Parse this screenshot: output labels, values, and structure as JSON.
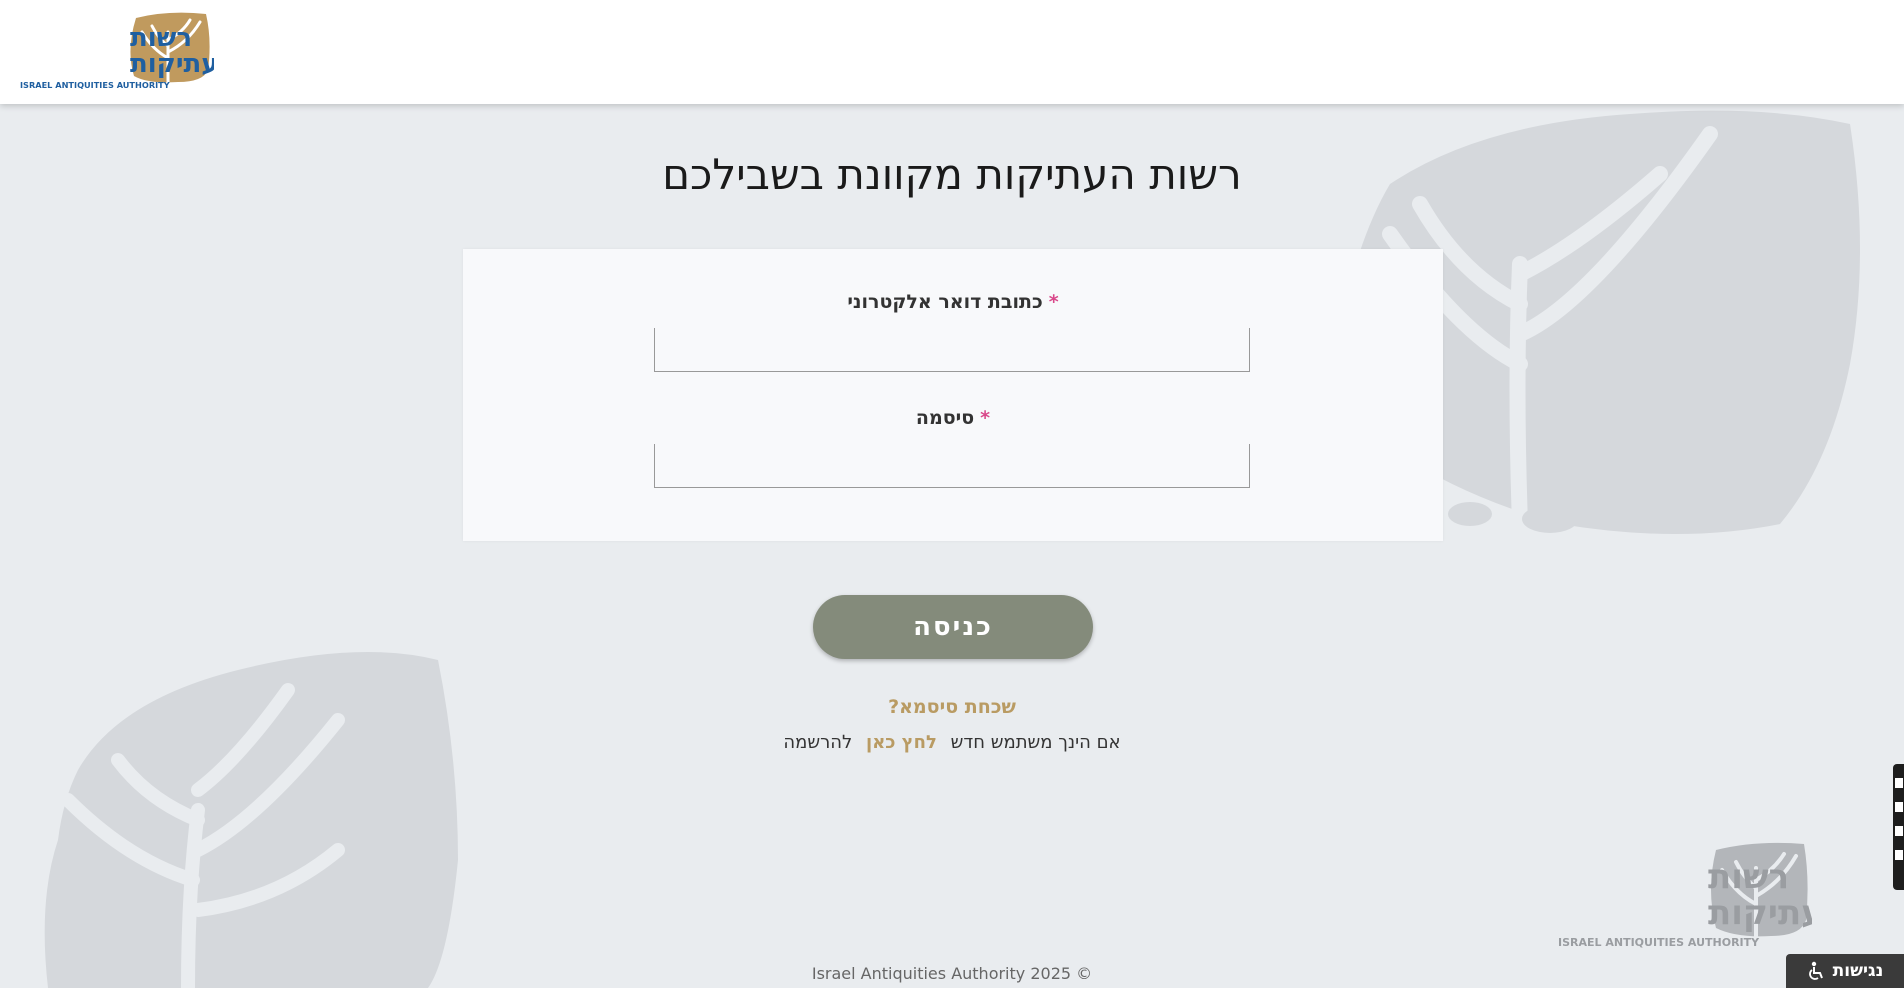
{
  "header": {
    "logo": {
      "hebrew_line1": "רשות",
      "hebrew_line2": "העתיקות",
      "english": "ISRAEL ANTIQUITIES AUTHORITY"
    }
  },
  "main": {
    "title": "רשות העתיקות מקוונת בשבילכם",
    "form": {
      "email_label": "כתובת דואר אלקטרוני",
      "email_required_mark": "*",
      "email_value": "",
      "password_label": "סיסמה",
      "password_required_mark": "*",
      "password_value": ""
    },
    "login_button": "כניסה",
    "forgot_password": "שכחת סיסמא?",
    "register": {
      "prefix": "אם הינך משתמש חדש",
      "link": "לחץ כאן",
      "suffix": "להרשמה"
    }
  },
  "footer": {
    "logo": {
      "hebrew_line1": "רשות",
      "hebrew_line2": "העתיקות",
      "english": "ISRAEL ANTIQUITIES AUTHORITY"
    },
    "copyright": "Israel Antiquities Authority 2025 ©"
  },
  "accessibility": {
    "label": "נגישות",
    "icon": "wheelchair-icon"
  },
  "colors": {
    "accent_gold": "#b99b63",
    "button_green": "#848b7b",
    "required_pink": "#d9488a",
    "logo_blue": "#1f5fa0",
    "logo_gold": "#c09a5e"
  }
}
